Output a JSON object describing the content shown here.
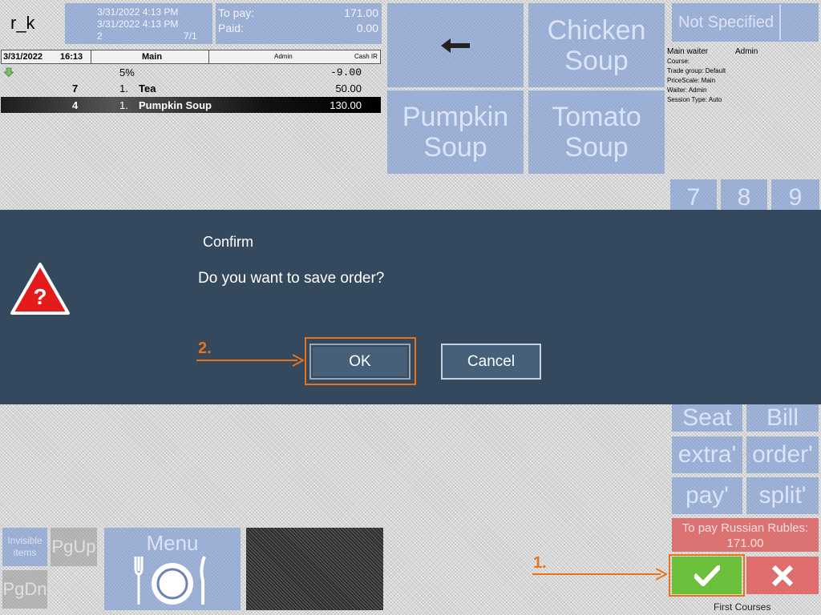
{
  "header": {
    "user": "r_k",
    "order_info": {
      "line1": "3/31/2022   4:13 PM",
      "line2": "3/31/2022   4:13 PM",
      "line3_left": "2",
      "line3_right": "7/1"
    },
    "to_pay_label": "To pay:",
    "to_pay_value": "171.00",
    "paid_label": "Paid:",
    "paid_value": "0.00"
  },
  "order_header": {
    "date": "3/31/2022",
    "time": "16:13",
    "hall": "Main",
    "waiter": "Admin",
    "cash": "Cash IR"
  },
  "order_rows": [
    {
      "qty": "",
      "num": "5%",
      "name": "",
      "price": "-9.00",
      "type": "discount"
    },
    {
      "qty": "7",
      "num": "1.",
      "name": "Tea",
      "price": "50.00",
      "type": "item"
    },
    {
      "qty": "4",
      "num": "1.",
      "name": "Pumpkin Soup",
      "price": "130.00",
      "type": "selected"
    }
  ],
  "menu_tiles": {
    "chicken": "Chicken Soup",
    "pumpkin": "Pumpkin Soup",
    "tomato": "Tomato Soup"
  },
  "info_panel": {
    "not_specified": "Not Specified",
    "main_waiter_label": "Main waiter",
    "main_waiter_value": "Admin",
    "course": "Course:",
    "trade_group": "Trade group: Default",
    "price_scale": "PriceScale: Main",
    "waiter": "Waiter: Admin",
    "session_type": "Session Type: Auto"
  },
  "numpad": [
    "7",
    "8",
    "9"
  ],
  "dialog": {
    "title": "Confirm",
    "message": "Do you want to save order?",
    "ok_label": "OK",
    "cancel_label": "Cancel",
    "step1": "1.",
    "step2": "2."
  },
  "side_buttons": {
    "seat": "Seat",
    "bill": "Bill",
    "extra": "extra'",
    "order": "order'",
    "pay": "pay'",
    "split": "split'"
  },
  "to_pay_rubles_label": "To pay Russian Rubles:",
  "to_pay_rubles_value": "171.00",
  "bottom": {
    "invisible_items": "Invisible items",
    "pgup": "PgUp",
    "pgdn": "PgDn",
    "menu": "Menu",
    "footer": "First Courses"
  },
  "colors": {
    "dialog_bg": "#34495e",
    "highlight": "#e8731a",
    "confirm_green": "#6cbf3a",
    "cancel_red": "#e05a5a",
    "tile_blue": "#7896d2"
  },
  "icons": [
    "back-arrow-icon",
    "question-warning-icon",
    "checkmark-icon",
    "x-icon",
    "plate-icon",
    "discount-arrow-icon"
  ]
}
